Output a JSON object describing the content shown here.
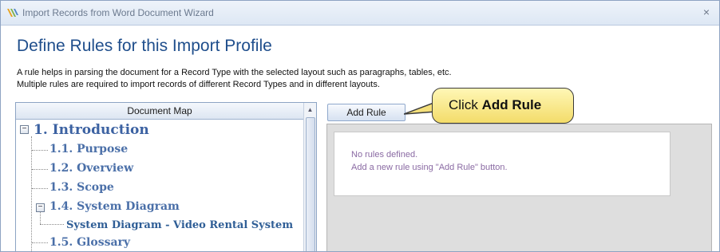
{
  "window": {
    "title": "Import Records from Word Document Wizard",
    "close_glyph": "×",
    "icon": "app-logo-icon"
  },
  "page": {
    "heading": "Define Rules for this Import Profile",
    "description_line1": "A rule helps in parsing the document for a Record Type with the selected layout such as paragraphs, tables, etc.",
    "description_line2": "Multiple rules are required to import records of different Record Types and in different layouts."
  },
  "document_map": {
    "header": "Document Map",
    "nodes": [
      {
        "label": "1. Introduction",
        "level": 1,
        "expanded": true
      },
      {
        "label": "1.1. Purpose",
        "level": 2
      },
      {
        "label": "1.2. Overview",
        "level": 2
      },
      {
        "label": "1.3. Scope",
        "level": 2
      },
      {
        "label": "1.4. System Diagram",
        "level": 2,
        "expanded": true
      },
      {
        "label": "System Diagram - Video Rental System",
        "level": 3
      },
      {
        "label": "1.5. Glossary",
        "level": 2
      }
    ],
    "expander_glyph": "−"
  },
  "rules": {
    "add_button_label": "Add Rule",
    "empty_line1": "No rules defined.",
    "empty_line2": "Add a new rule using \"Add Rule\" button."
  },
  "callout": {
    "prefix": "Click ",
    "emphasis": "Add Rule"
  },
  "colors": {
    "heading": "#1f4e8c",
    "tree_text": "#4a6fa8",
    "empty_text": "#8a6aa3",
    "callout_fill": "#f7e27a"
  }
}
